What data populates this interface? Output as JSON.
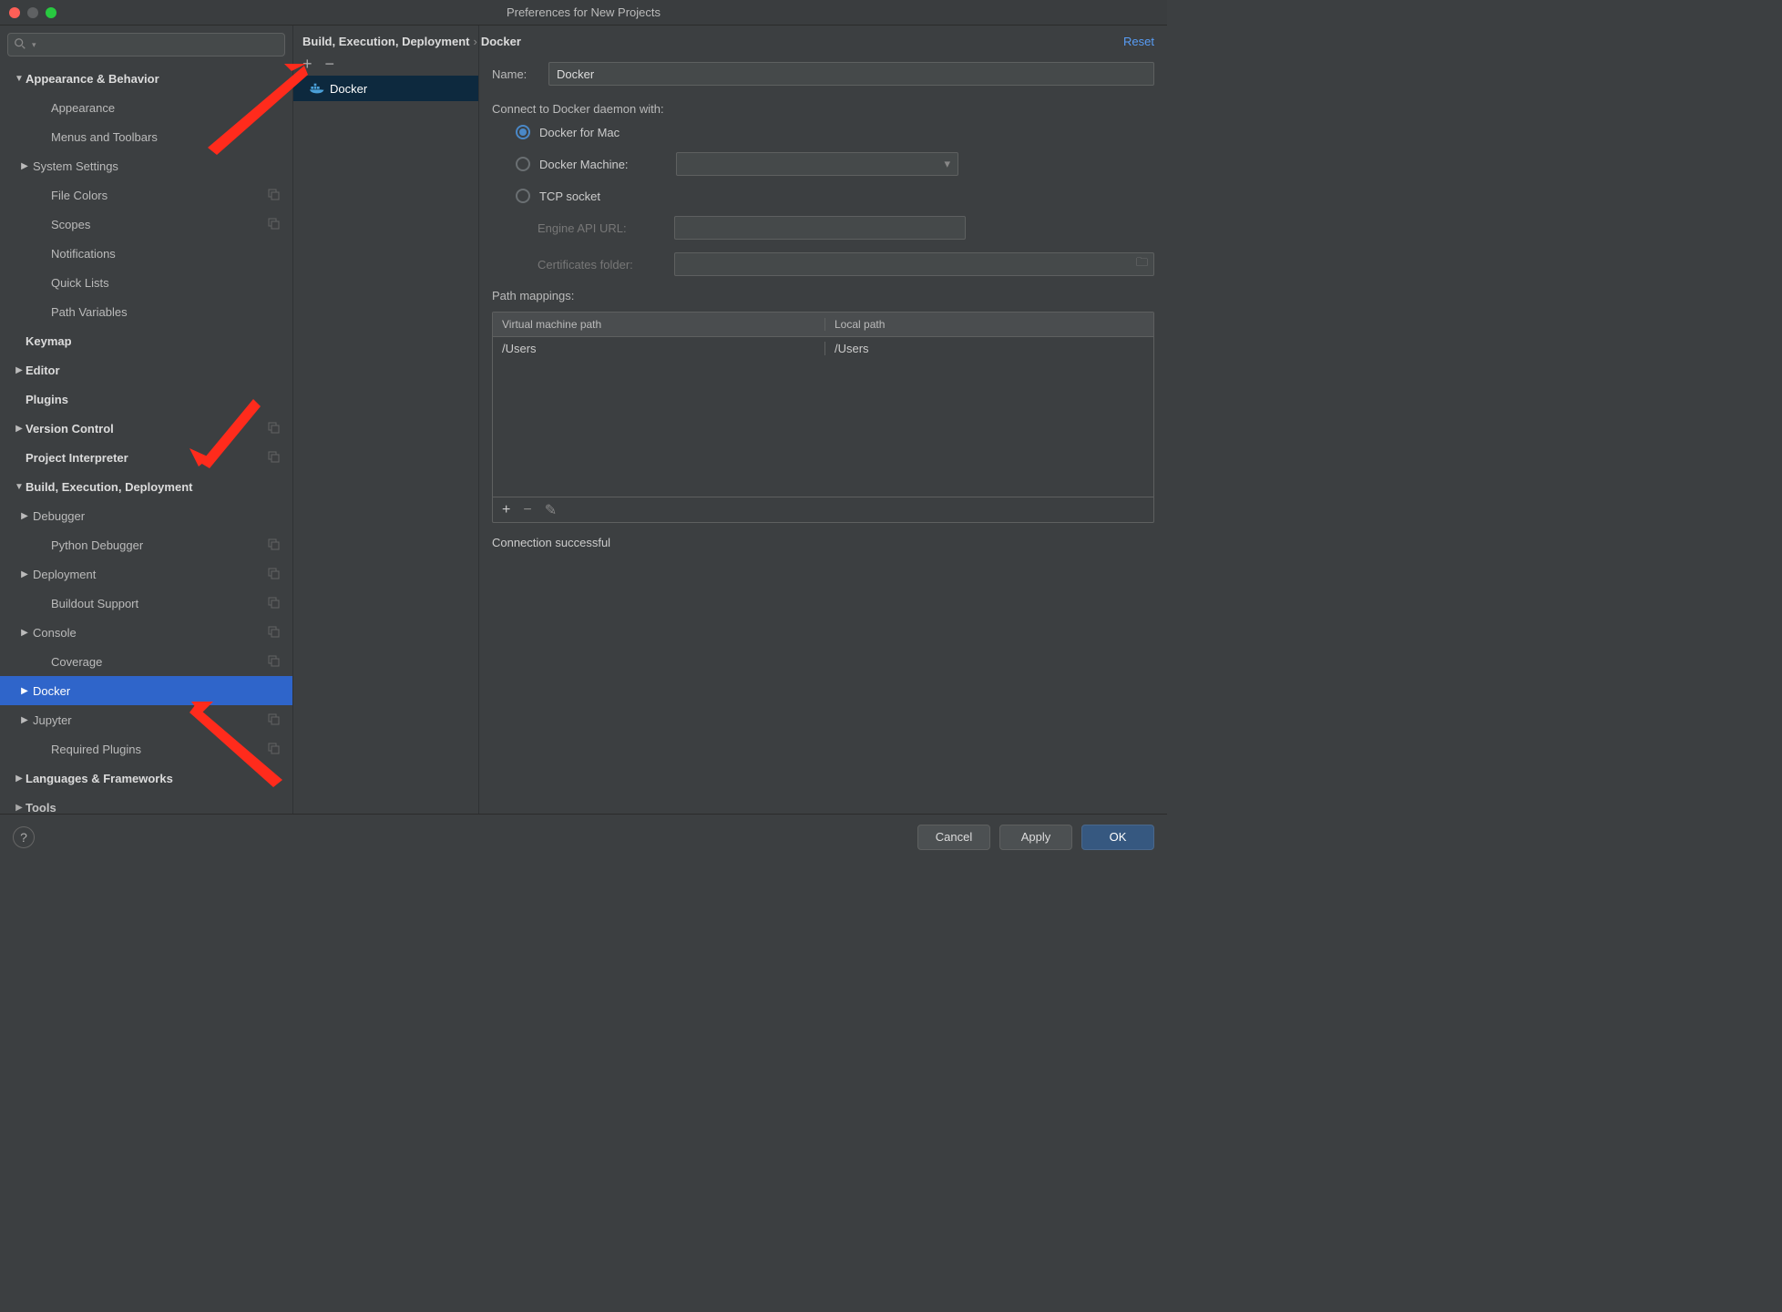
{
  "window": {
    "title": "Preferences for New Projects"
  },
  "reset_label": "Reset",
  "breadcrumb": {
    "a": "Build, Execution, Deployment",
    "b": "Docker"
  },
  "toolbar": {
    "add": "+",
    "remove": "−"
  },
  "list": {
    "items": [
      {
        "label": "Docker",
        "selected": true
      }
    ]
  },
  "form": {
    "name_label": "Name:",
    "name_value": "Docker",
    "connect_label": "Connect to Docker daemon with:",
    "radio_mac": "Docker for Mac",
    "radio_machine": "Docker Machine:",
    "radio_tcp": "TCP socket",
    "engine_label": "Engine API URL:",
    "certs_label": "Certificates folder:",
    "path_label": "Path mappings:",
    "col_a": "Virtual machine path",
    "col_b": "Local path",
    "row_a": "/Users",
    "row_b": "/Users",
    "pt_add": "+",
    "pt_remove": "−",
    "pt_edit": "✎",
    "status": "Connection successful"
  },
  "buttons": {
    "help": "?",
    "cancel": "Cancel",
    "apply": "Apply",
    "ok": "OK"
  },
  "tree": [
    {
      "label": "Appearance & Behavior",
      "top": true,
      "arrow": "down"
    },
    {
      "label": "Appearance",
      "plainchild": true
    },
    {
      "label": "Menus and Toolbars",
      "plainchild": true
    },
    {
      "label": "System Settings",
      "child": true,
      "arrow": "right"
    },
    {
      "label": "File Colors",
      "plainchild": true,
      "copy": true
    },
    {
      "label": "Scopes",
      "plainchild": true,
      "copy": true
    },
    {
      "label": "Notifications",
      "plainchild": true
    },
    {
      "label": "Quick Lists",
      "plainchild": true
    },
    {
      "label": "Path Variables",
      "plainchild": true
    },
    {
      "label": "Keymap",
      "top": true
    },
    {
      "label": "Editor",
      "top": true,
      "arrow": "right"
    },
    {
      "label": "Plugins",
      "top": true
    },
    {
      "label": "Version Control",
      "top": true,
      "arrow": "right",
      "copy": true
    },
    {
      "label": "Project Interpreter",
      "top": true,
      "copy": true
    },
    {
      "label": "Build, Execution, Deployment",
      "top": true,
      "arrow": "down"
    },
    {
      "label": "Debugger",
      "child": true,
      "arrow": "right"
    },
    {
      "label": "Python Debugger",
      "plainchild": true,
      "copy": true
    },
    {
      "label": "Deployment",
      "child": true,
      "arrow": "right",
      "copy": true
    },
    {
      "label": "Buildout Support",
      "plainchild": true,
      "copy": true
    },
    {
      "label": "Console",
      "child": true,
      "arrow": "right",
      "copy": true
    },
    {
      "label": "Coverage",
      "plainchild": true,
      "copy": true
    },
    {
      "label": "Docker",
      "child": true,
      "arrow": "right",
      "selected": true
    },
    {
      "label": "Jupyter",
      "child": true,
      "arrow": "right",
      "copy": true
    },
    {
      "label": "Required Plugins",
      "plainchild": true,
      "copy": true
    },
    {
      "label": "Languages & Frameworks",
      "top": true,
      "arrow": "right"
    },
    {
      "label": "Tools",
      "top": true,
      "arrow": "right",
      "cut": true
    }
  ]
}
